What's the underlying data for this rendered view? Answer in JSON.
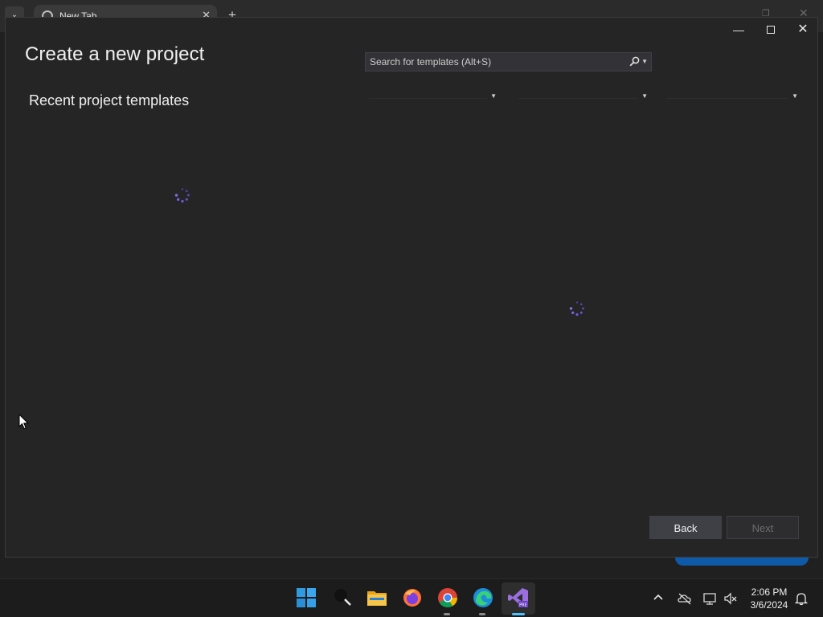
{
  "browser": {
    "tab_title": "New Tab"
  },
  "dialog": {
    "title": "Create a new project",
    "recent_heading": "Recent project templates",
    "search": {
      "placeholder": "Search for templates (Alt+S)",
      "value": ""
    },
    "filters": [
      {
        "selected": ""
      },
      {
        "selected": ""
      },
      {
        "selected": ""
      }
    ],
    "buttons": {
      "back": "Back",
      "next": "Next"
    }
  },
  "taskbar": {
    "apps": [
      "start-icon",
      "search-icon",
      "file-explorer-icon",
      "firefox-icon",
      "chrome-icon",
      "edge-icon",
      "visual-studio-preview-icon"
    ],
    "vs_badge": "PRE",
    "clock": {
      "time": "2:06 PM",
      "date": "3/6/2024"
    }
  },
  "colors": {
    "dialog_bg": "#252526",
    "accent": "#0f5aa8",
    "spinner": "#6e5cd6"
  }
}
